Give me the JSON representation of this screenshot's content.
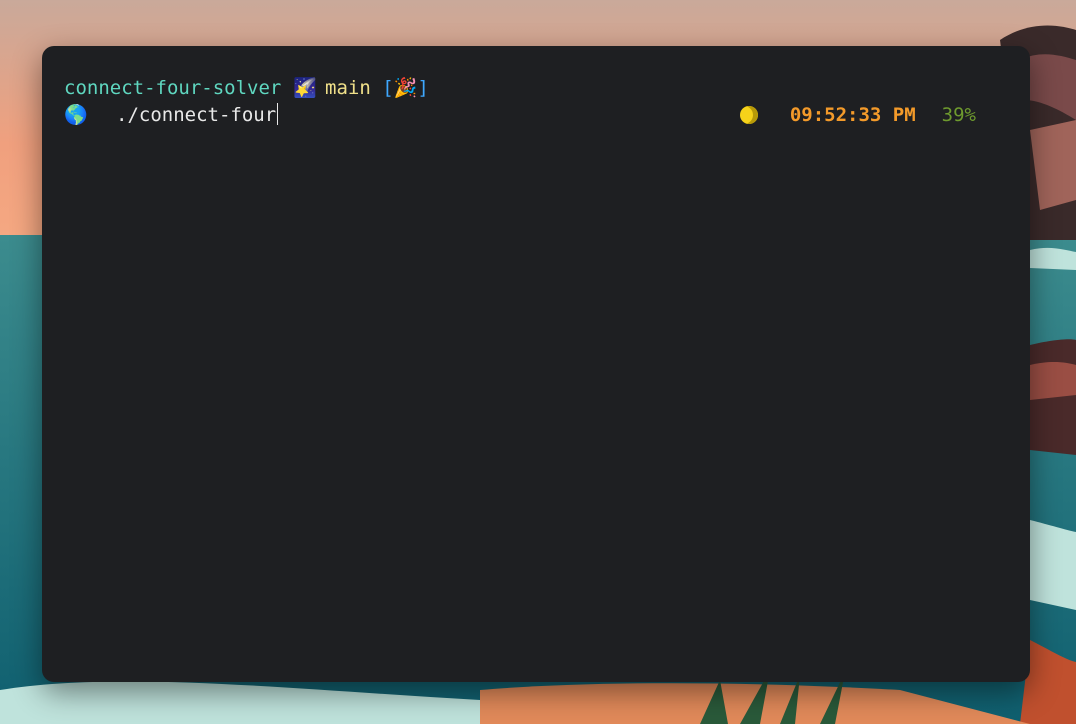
{
  "terminal": {
    "directory": "connect-four-solver",
    "branch_icon": "🌠",
    "branch": "main",
    "status_open": "[",
    "status_icon": "🎉",
    "status_close": "]",
    "prompt_icon": "🌎",
    "command": "./connect-four",
    "right_prompt": {
      "moon_icon": "crescent-moon-icon",
      "time": "09:52:33 PM",
      "battery": "39%"
    }
  },
  "colors": {
    "directory": "#5fd7c0",
    "branch": "#f0e08a",
    "bracket": "#3fa8ff",
    "time": "#f39a2a",
    "battery": "#6e9a2e",
    "terminal_bg": "#1e1f22"
  }
}
